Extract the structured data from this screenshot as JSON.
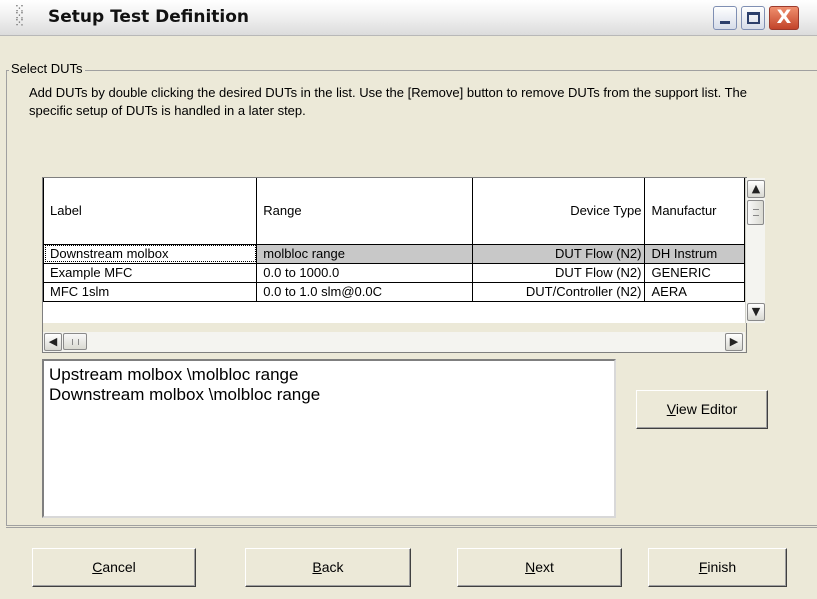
{
  "window": {
    "title": "Setup Test Definition",
    "minimize_glyph": "",
    "close_glyph": "X"
  },
  "group": {
    "legend": "Select DUTs",
    "instructions": "Add DUTs by double clicking the desired DUTs in the list.  Use the [Remove] button to remove DUTs from the support list.  The specific setup of DUTs is handled in a later step."
  },
  "grid": {
    "columns": [
      "Label",
      "Range",
      "Device Type",
      "Manufactur"
    ],
    "rows": [
      {
        "label": "Downstream molbox",
        "range": "molbloc range",
        "device_type": "DUT Flow (N2)",
        "manufacturer": "DH Instrum"
      },
      {
        "label": "Example MFC",
        "range": "0.0 to 1000.0",
        "device_type": "DUT Flow (N2)",
        "manufacturer": "GENERIC"
      },
      {
        "label": "MFC 1slm",
        "range": "0.0 to 1.0 slm@0.0C",
        "device_type": "DUT/Controller (N2)",
        "manufacturer": "AERA"
      }
    ],
    "selected_row_index": 0
  },
  "selected_duts": [
    "Upstream molbox \\molbloc range",
    "Downstream molbox \\molbloc range"
  ],
  "buttons": {
    "view_editor": {
      "accel": "V",
      "rest": "iew Editor"
    },
    "cancel": {
      "accel": "C",
      "rest": "ancel"
    },
    "back": {
      "accel": "B",
      "rest": "ack"
    },
    "next": {
      "accel": "N",
      "rest": "ext"
    },
    "finish": {
      "accel": "F",
      "rest": "inish"
    }
  },
  "icons": {
    "app": "setup-app-icon",
    "scroll_up": "scroll-up-icon",
    "scroll_down": "scroll-down-icon",
    "scroll_left": "scroll-left-icon",
    "scroll_right": "scroll-right-icon"
  },
  "colors": {
    "dialog_bg": "#ece9d8",
    "selection_bg": "#c8c8c8",
    "close_button": "#c2442a"
  }
}
